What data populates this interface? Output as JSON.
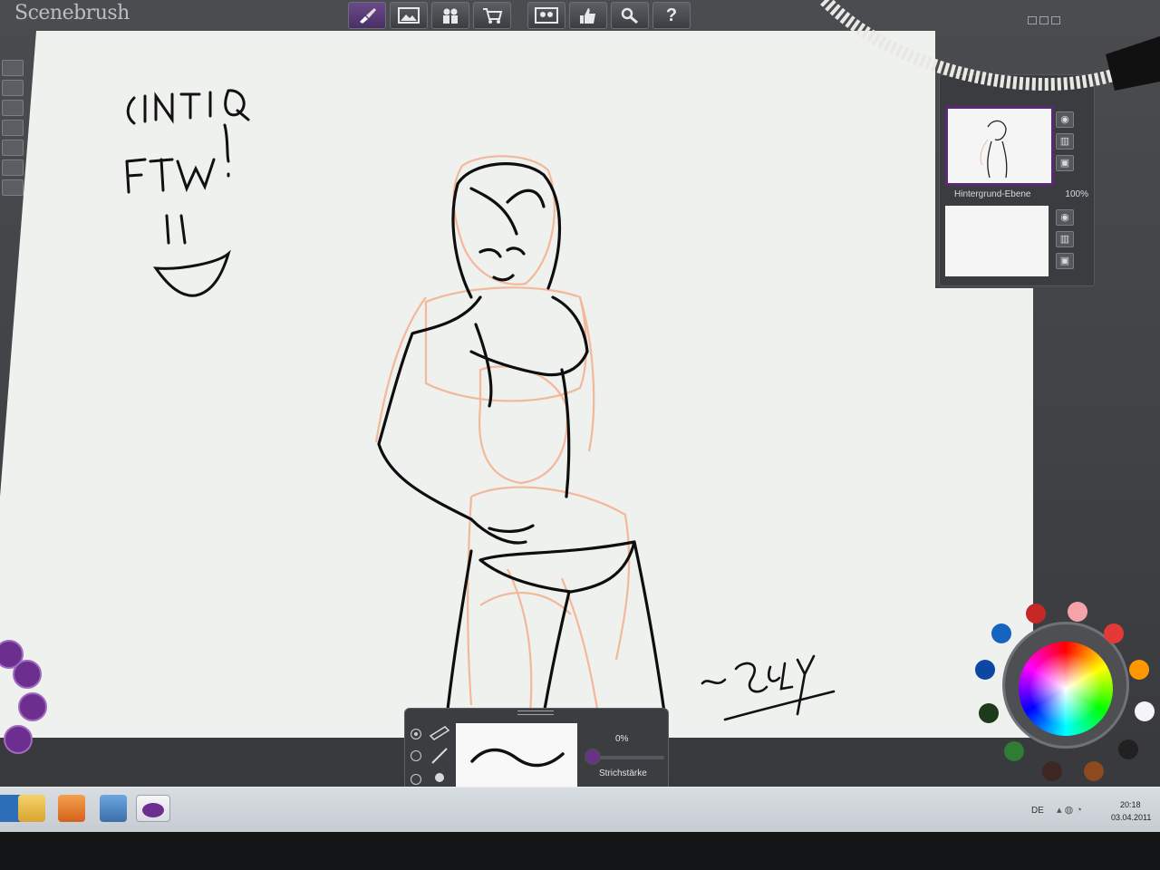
{
  "app": {
    "title": "Scenebrush"
  },
  "toolbar": {
    "buttons": [
      {
        "icon": "brush-icon"
      },
      {
        "icon": "image-icon"
      },
      {
        "icon": "people-icon"
      },
      {
        "icon": "cart-icon"
      },
      {
        "icon": "community-icon"
      },
      {
        "icon": "rating-icon"
      },
      {
        "icon": "settings-icon"
      },
      {
        "icon": "help-icon",
        "label": "?"
      }
    ]
  },
  "canvas": {
    "handwriting": [
      "CINTIQ",
      "FTW!"
    ],
    "signature": "~ Seay"
  },
  "layers": {
    "items": [
      {
        "name": "",
        "opacity": ""
      },
      {
        "name": "Hintergrund-Ebene",
        "opacity": "100%"
      }
    ]
  },
  "brush_panel": {
    "opacity_value": "0%",
    "stroke_label": "Strichstärke",
    "radio_selected": 0
  },
  "colors": {
    "accent": "#6d2f8f",
    "swatches": [
      "#c62828",
      "#f4a3a8",
      "#e53935",
      "#1565c0",
      "#ff9800",
      "#0d47a1",
      "#f5f5f5",
      "#1b3b1b",
      "#2e7d32",
      "#212121",
      "#3e2723",
      "#8d4a1f",
      "#263238"
    ]
  },
  "taskbar": {
    "language": "DE",
    "time": "20:18",
    "date": "03.04.2011"
  }
}
